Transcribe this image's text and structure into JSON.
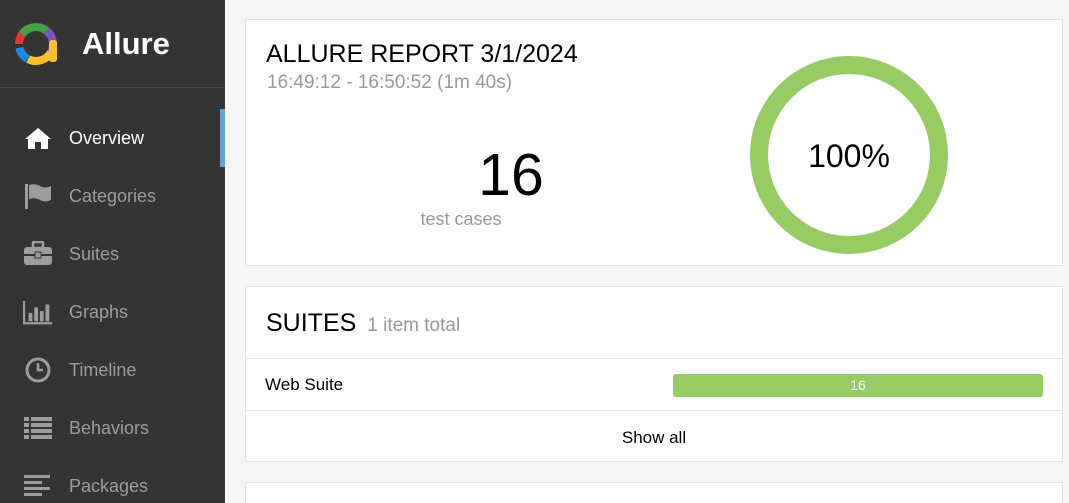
{
  "brand": {
    "name": "Allure"
  },
  "nav": [
    {
      "label": "Overview",
      "icon": "home-icon",
      "active": true
    },
    {
      "label": "Categories",
      "icon": "flag-icon",
      "active": false
    },
    {
      "label": "Suites",
      "icon": "briefcase-icon",
      "active": false
    },
    {
      "label": "Graphs",
      "icon": "bar-chart-icon",
      "active": false
    },
    {
      "label": "Timeline",
      "icon": "clock-icon",
      "active": false
    },
    {
      "label": "Behaviors",
      "icon": "list-icon",
      "active": false
    },
    {
      "label": "Packages",
      "icon": "align-left-icon",
      "active": false
    }
  ],
  "summary": {
    "title": "ALLURE REPORT 3/1/2024",
    "time_range": "16:49:12 - 16:50:52 (1m 40s)",
    "test_count": "16",
    "test_count_label": "test cases",
    "success_rate_label": "100%",
    "success_rate": 1.0
  },
  "suites": {
    "title": "SUITES",
    "total_label": "1 item total",
    "items": [
      {
        "name": "Web Suite",
        "count": "16"
      }
    ],
    "show_all_label": "Show all"
  },
  "colors": {
    "sidebar_bg": "#343434",
    "passed": "#97cc64",
    "active_marker": "#6aa0d8",
    "muted_text": "#999999"
  }
}
